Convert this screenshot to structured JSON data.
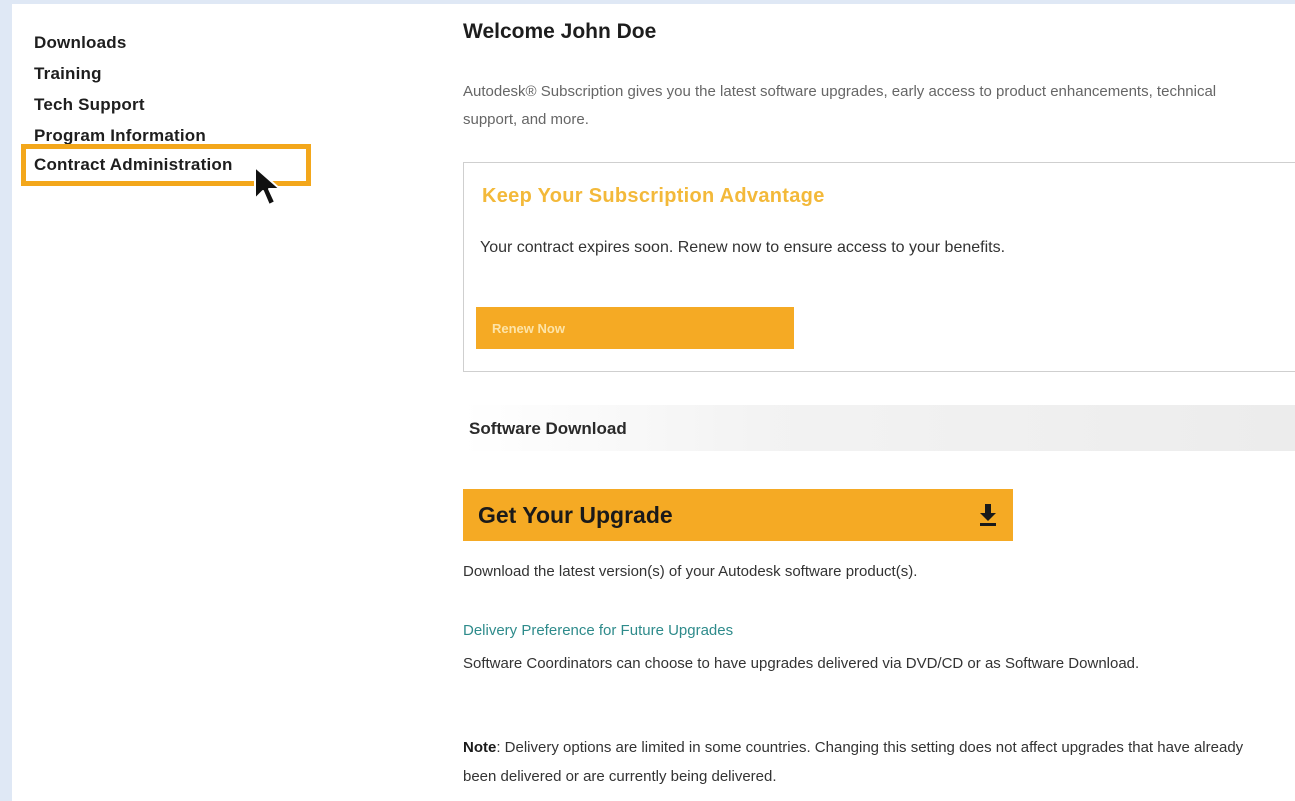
{
  "sidebar": {
    "items": [
      {
        "label": "Downloads"
      },
      {
        "label": "Training"
      },
      {
        "label": "Tech Support"
      },
      {
        "label": "Program Information"
      },
      {
        "label": "Contract Administration",
        "active": true
      }
    ]
  },
  "main": {
    "welcome": "Welcome John Doe",
    "intro": "Autodesk® Subscription gives you the latest software upgrades, early access to product enhancements, technical support, and more.",
    "subscription_box": {
      "title": "Keep Your Subscription Advantage",
      "text": "Your contract expires soon. Renew now to ensure access to your benefits.",
      "button_label": "Renew Now"
    },
    "section_title": "Software Download",
    "upgrade_button_label": "Get Your Upgrade",
    "upgrade_description": "Download the latest version(s) of your Autodesk software product(s).",
    "delivery_link": "Delivery Preference for Future Upgrades",
    "delivery_text": "Software Coordinators can choose to have upgrades delivered via DVD/CD or as Software Download.",
    "note_label": "Note",
    "note_text": ": Delivery options are limited in some countries. Changing this setting does not affect upgrades that have already been delivered or are currently being delivered."
  },
  "colors": {
    "accent": "#f5aa24",
    "highlight_outline": "#f3a71b",
    "box_title": "#f3b93a",
    "link": "#2e8b8b",
    "background": "#dfe8f5"
  },
  "icons": {
    "cursor": "mouse-pointer-icon",
    "download": "download-icon"
  }
}
